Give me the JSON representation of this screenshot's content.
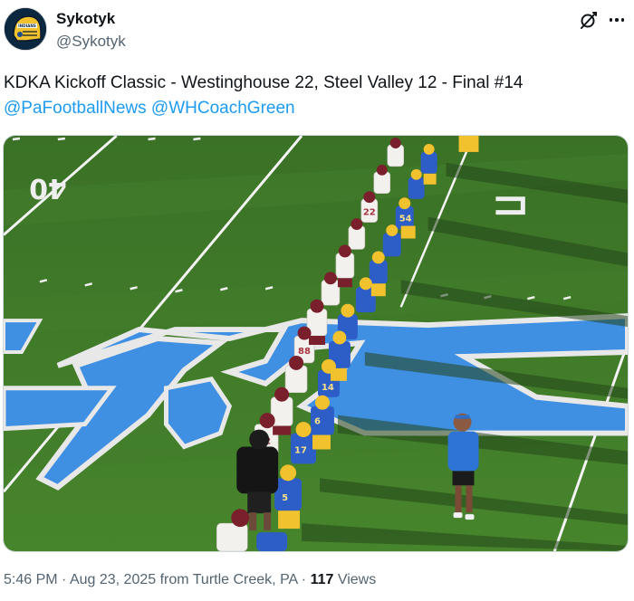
{
  "author": {
    "display_name": "Sykotyk",
    "handle": "@Sykotyk",
    "avatar_icon": "football-helmet-avatar",
    "avatar_text": "INDIANS"
  },
  "header_icons": [
    "grok-icon",
    "more-options-icon"
  ],
  "tweet": {
    "text": "KDKA Kickoff Classic - Westinghouse 22, Steel Valley 12 - Final #14",
    "mentions": [
      "@PaFootballNews",
      "@WHCoachGreen"
    ]
  },
  "media": {
    "field_number_left": "40",
    "field_logo_letter": "K",
    "colors": {
      "turf": "#3f7a28",
      "logo_blue": "#3f8fe3",
      "westinghouse_gold": "#f2c12e",
      "westinghouse_blue": "#2d5ec8",
      "steel_valley_maroon": "#7a1f2c"
    }
  },
  "meta": {
    "time": "5:46 PM",
    "date": "Aug 23, 2025",
    "location": "from Turtle Creek, PA",
    "views_count": "117",
    "views_label": "Views"
  },
  "colors": {
    "link": "#1d9bf0",
    "secondary_text": "#536471",
    "primary_text": "#0f1419"
  }
}
